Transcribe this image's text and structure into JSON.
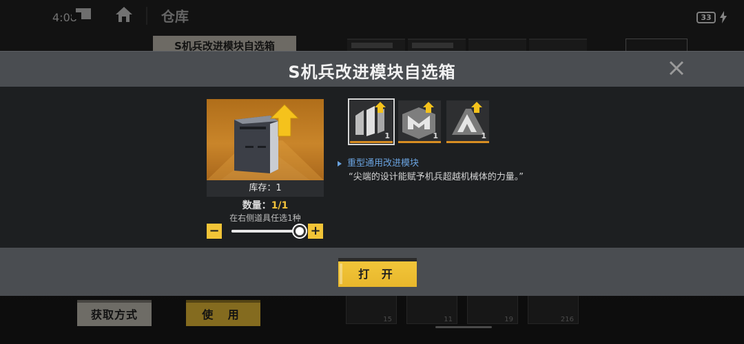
{
  "status_bar": {
    "time": "4:08",
    "battery": "33"
  },
  "background_page": {
    "title": "仓库",
    "item_title": "S机兵改进模块自选箱",
    "btn_acquire": "获取方式",
    "btn_use": "使 用",
    "bottom_cards": [
      {
        "count": "15"
      },
      {
        "count": "11"
      },
      {
        "count": "19"
      },
      {
        "count": "216"
      }
    ]
  },
  "modal": {
    "title": "S机兵改进模块自选箱",
    "stock_label": "库存：1",
    "quantity_label": "数量：",
    "quantity_value": "1/1",
    "hint": "在右侧道具任选1种",
    "slider_fraction": 1.0,
    "options": [
      {
        "icon": "heavy-module-icon",
        "count": "1",
        "selected": true
      },
      {
        "icon": "m-module-icon",
        "count": "1",
        "selected": false
      },
      {
        "icon": "a-module-icon",
        "count": "1",
        "selected": false
      }
    ],
    "selected_name": "重型通用改进模块",
    "selected_quote": "“尖端的设计能赋予机兵超越机械体的力量。”",
    "open_button": "打 开"
  },
  "colors": {
    "accent_yellow": "#f2c437",
    "link_blue": "#6aa3e0",
    "header_gray": "#4a4d51"
  }
}
